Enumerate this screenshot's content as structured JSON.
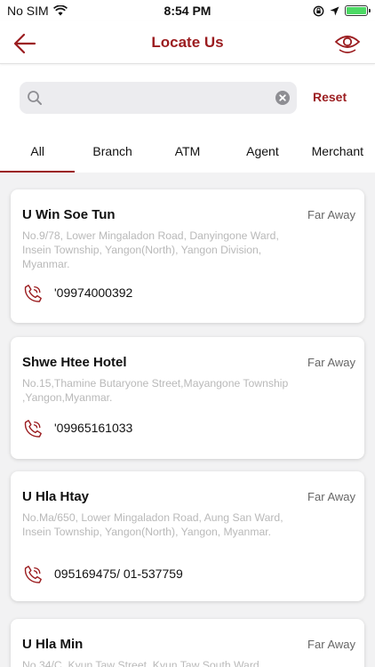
{
  "status_bar": {
    "carrier": "No SIM",
    "time": "8:54 PM"
  },
  "nav": {
    "title": "Locate Us"
  },
  "search": {
    "placeholder": "",
    "value": "",
    "reset_label": "Reset"
  },
  "tabs": [
    {
      "label": "All",
      "active": true
    },
    {
      "label": "Branch",
      "active": false
    },
    {
      "label": "ATM",
      "active": false
    },
    {
      "label": "Agent",
      "active": false
    },
    {
      "label": "Merchant",
      "active": false
    }
  ],
  "locations": [
    {
      "name": "U Win Soe Tun",
      "distance": "Far Away",
      "address": "No.9/78, Lower Mingaladon Road, Danyingone Ward, Insein Township, Yangon(North), Yangon Division, Myanmar.",
      "phone": "'09974000392"
    },
    {
      "name": "Shwe Htee Hotel",
      "distance": "Far Away",
      "address": "No.15,Thamine Butaryone Street,Mayangone Township ,Yangon,Myanmar.",
      "phone": "'09965161033"
    },
    {
      "name": "U Hla Htay",
      "distance": "Far Away",
      "address": "No.Ma/650, Lower Mingaladon Road, Aung San Ward, Insein Township, Yangon(North), Yangon, Myanmar.",
      "phone": "095169475/ 01-537759"
    },
    {
      "name": "U Hla Min",
      "distance": "Far Away",
      "address": "No.34/C, Kyun Taw Street, Kyun Taw South Ward",
      "phone": ""
    }
  ],
  "colors": {
    "accent": "#9b1c1f",
    "list_bg": "#f2f2f3",
    "address_text": "#b9b9b9",
    "battery": "#4cd964"
  },
  "icons": [
    "back-arrow-icon",
    "eye-icon",
    "search-icon",
    "clear-icon",
    "phone-icon",
    "wifi-icon",
    "location-arrow-icon",
    "rotation-lock-icon",
    "battery-icon"
  ]
}
